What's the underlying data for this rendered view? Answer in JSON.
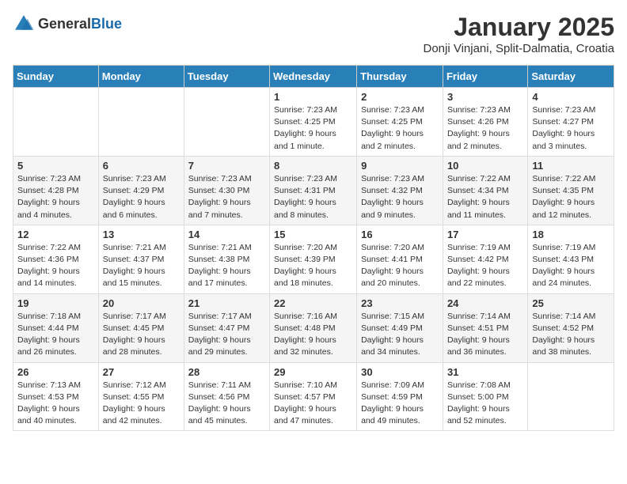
{
  "header": {
    "logo_general": "General",
    "logo_blue": "Blue",
    "title": "January 2025",
    "subtitle": "Donji Vinjani, Split-Dalmatia, Croatia"
  },
  "days_of_week": [
    "Sunday",
    "Monday",
    "Tuesday",
    "Wednesday",
    "Thursday",
    "Friday",
    "Saturday"
  ],
  "weeks": [
    [
      {
        "num": "",
        "info": ""
      },
      {
        "num": "",
        "info": ""
      },
      {
        "num": "",
        "info": ""
      },
      {
        "num": "1",
        "info": "Sunrise: 7:23 AM\nSunset: 4:25 PM\nDaylight: 9 hours\nand 1 minute."
      },
      {
        "num": "2",
        "info": "Sunrise: 7:23 AM\nSunset: 4:25 PM\nDaylight: 9 hours\nand 2 minutes."
      },
      {
        "num": "3",
        "info": "Sunrise: 7:23 AM\nSunset: 4:26 PM\nDaylight: 9 hours\nand 2 minutes."
      },
      {
        "num": "4",
        "info": "Sunrise: 7:23 AM\nSunset: 4:27 PM\nDaylight: 9 hours\nand 3 minutes."
      }
    ],
    [
      {
        "num": "5",
        "info": "Sunrise: 7:23 AM\nSunset: 4:28 PM\nDaylight: 9 hours\nand 4 minutes."
      },
      {
        "num": "6",
        "info": "Sunrise: 7:23 AM\nSunset: 4:29 PM\nDaylight: 9 hours\nand 6 minutes."
      },
      {
        "num": "7",
        "info": "Sunrise: 7:23 AM\nSunset: 4:30 PM\nDaylight: 9 hours\nand 7 minutes."
      },
      {
        "num": "8",
        "info": "Sunrise: 7:23 AM\nSunset: 4:31 PM\nDaylight: 9 hours\nand 8 minutes."
      },
      {
        "num": "9",
        "info": "Sunrise: 7:23 AM\nSunset: 4:32 PM\nDaylight: 9 hours\nand 9 minutes."
      },
      {
        "num": "10",
        "info": "Sunrise: 7:22 AM\nSunset: 4:34 PM\nDaylight: 9 hours\nand 11 minutes."
      },
      {
        "num": "11",
        "info": "Sunrise: 7:22 AM\nSunset: 4:35 PM\nDaylight: 9 hours\nand 12 minutes."
      }
    ],
    [
      {
        "num": "12",
        "info": "Sunrise: 7:22 AM\nSunset: 4:36 PM\nDaylight: 9 hours\nand 14 minutes."
      },
      {
        "num": "13",
        "info": "Sunrise: 7:21 AM\nSunset: 4:37 PM\nDaylight: 9 hours\nand 15 minutes."
      },
      {
        "num": "14",
        "info": "Sunrise: 7:21 AM\nSunset: 4:38 PM\nDaylight: 9 hours\nand 17 minutes."
      },
      {
        "num": "15",
        "info": "Sunrise: 7:20 AM\nSunset: 4:39 PM\nDaylight: 9 hours\nand 18 minutes."
      },
      {
        "num": "16",
        "info": "Sunrise: 7:20 AM\nSunset: 4:41 PM\nDaylight: 9 hours\nand 20 minutes."
      },
      {
        "num": "17",
        "info": "Sunrise: 7:19 AM\nSunset: 4:42 PM\nDaylight: 9 hours\nand 22 minutes."
      },
      {
        "num": "18",
        "info": "Sunrise: 7:19 AM\nSunset: 4:43 PM\nDaylight: 9 hours\nand 24 minutes."
      }
    ],
    [
      {
        "num": "19",
        "info": "Sunrise: 7:18 AM\nSunset: 4:44 PM\nDaylight: 9 hours\nand 26 minutes."
      },
      {
        "num": "20",
        "info": "Sunrise: 7:17 AM\nSunset: 4:45 PM\nDaylight: 9 hours\nand 28 minutes."
      },
      {
        "num": "21",
        "info": "Sunrise: 7:17 AM\nSunset: 4:47 PM\nDaylight: 9 hours\nand 29 minutes."
      },
      {
        "num": "22",
        "info": "Sunrise: 7:16 AM\nSunset: 4:48 PM\nDaylight: 9 hours\nand 32 minutes."
      },
      {
        "num": "23",
        "info": "Sunrise: 7:15 AM\nSunset: 4:49 PM\nDaylight: 9 hours\nand 34 minutes."
      },
      {
        "num": "24",
        "info": "Sunrise: 7:14 AM\nSunset: 4:51 PM\nDaylight: 9 hours\nand 36 minutes."
      },
      {
        "num": "25",
        "info": "Sunrise: 7:14 AM\nSunset: 4:52 PM\nDaylight: 9 hours\nand 38 minutes."
      }
    ],
    [
      {
        "num": "26",
        "info": "Sunrise: 7:13 AM\nSunset: 4:53 PM\nDaylight: 9 hours\nand 40 minutes."
      },
      {
        "num": "27",
        "info": "Sunrise: 7:12 AM\nSunset: 4:55 PM\nDaylight: 9 hours\nand 42 minutes."
      },
      {
        "num": "28",
        "info": "Sunrise: 7:11 AM\nSunset: 4:56 PM\nDaylight: 9 hours\nand 45 minutes."
      },
      {
        "num": "29",
        "info": "Sunrise: 7:10 AM\nSunset: 4:57 PM\nDaylight: 9 hours\nand 47 minutes."
      },
      {
        "num": "30",
        "info": "Sunrise: 7:09 AM\nSunset: 4:59 PM\nDaylight: 9 hours\nand 49 minutes."
      },
      {
        "num": "31",
        "info": "Sunrise: 7:08 AM\nSunset: 5:00 PM\nDaylight: 9 hours\nand 52 minutes."
      },
      {
        "num": "",
        "info": ""
      }
    ]
  ]
}
